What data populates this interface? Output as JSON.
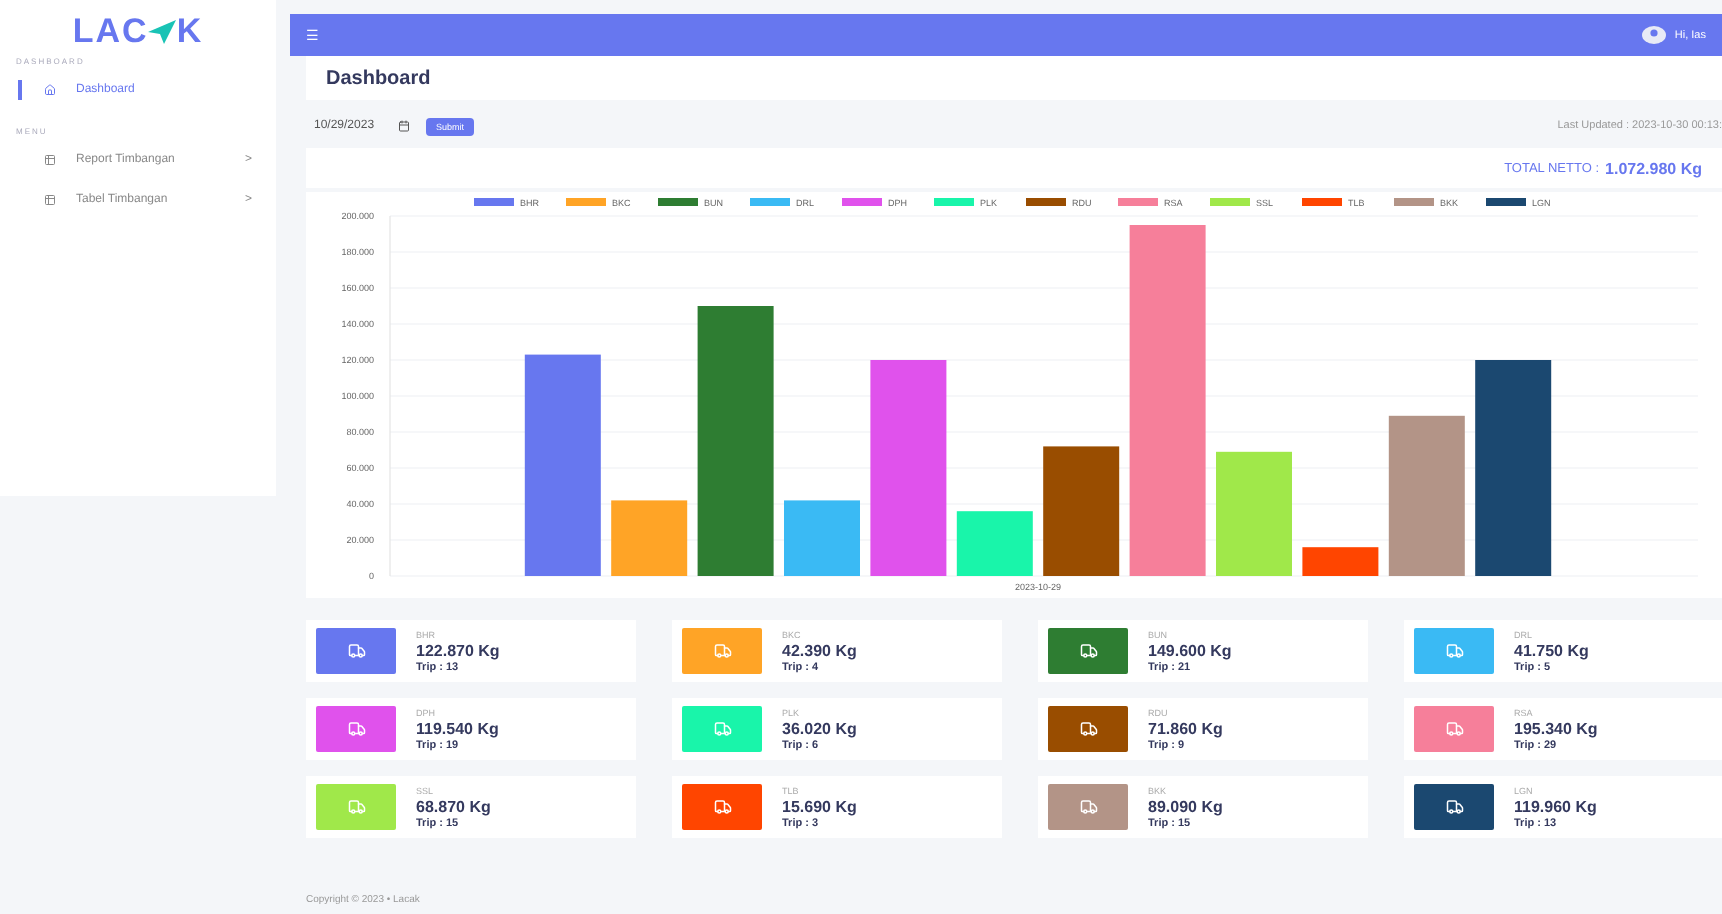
{
  "sidebar": {
    "logo": {
      "left": "LAC",
      "right": "K"
    },
    "sections": [
      {
        "heading": "DASHBOARD",
        "items": [
          {
            "label": "Dashboard",
            "selected": true
          }
        ]
      },
      {
        "heading": "MENU",
        "items": [
          {
            "label": "Report Timbangan",
            "selected": false,
            "arrow": ">"
          },
          {
            "label": "Tabel Timbangan",
            "selected": false,
            "arrow": ">"
          }
        ]
      }
    ]
  },
  "topbar": {
    "menu_icon": "☰",
    "user": "Hi, Ias"
  },
  "header": {
    "title": "Dashboard"
  },
  "filter": {
    "date": "10/29/2023",
    "submit": "Submit",
    "last_updated": "Last Updated : 2023-10-30 00:13:"
  },
  "total": {
    "label": "TOTAL NETTO :",
    "value": "1.072.980 Kg"
  },
  "chart": {
    "chart_data": {
      "type": "bar",
      "categories": [
        "2023-10-29"
      ],
      "ylim": [
        0,
        200000
      ],
      "grid": true,
      "legend": true,
      "yticks": [
        {
          "value": 0,
          "label": "0"
        },
        {
          "value": 20000,
          "label": "20.000"
        },
        {
          "value": 40000,
          "label": "40.000"
        },
        {
          "value": 60000,
          "label": "60.000"
        },
        {
          "value": 80000,
          "label": "80.000"
        },
        {
          "value": 100000,
          "label": "100.000"
        },
        {
          "value": 120000,
          "label": "120.000"
        },
        {
          "value": 140000,
          "label": "140.000"
        },
        {
          "value": 160000,
          "label": "160.000"
        },
        {
          "value": 180000,
          "label": "180.000"
        },
        {
          "value": 200000,
          "label": "200.000"
        }
      ],
      "series": [
        {
          "name": "BHR",
          "color": "#6777ef",
          "values": [
            123000
          ]
        },
        {
          "name": "BKC",
          "color": "#ffa426",
          "values": [
            42000
          ]
        },
        {
          "name": "BUN",
          "color": "#2e7d32",
          "values": [
            150000
          ]
        },
        {
          "name": "DRL",
          "color": "#3abaf4",
          "values": [
            42000
          ]
        },
        {
          "name": "DPH",
          "color": "#e052ec",
          "values": [
            120000
          ]
        },
        {
          "name": "PLK",
          "color": "#19f5aa",
          "values": [
            36000
          ]
        },
        {
          "name": "RDU",
          "color": "#994d00",
          "values": [
            72000
          ]
        },
        {
          "name": "RSA",
          "color": "#f67f9a",
          "values": [
            195000
          ]
        },
        {
          "name": "SSL",
          "color": "#a0e84a",
          "values": [
            69000
          ]
        },
        {
          "name": "TLB",
          "color": "#ff4500",
          "values": [
            16000
          ]
        },
        {
          "name": "BKK",
          "color": "#b39487",
          "values": [
            89000
          ]
        },
        {
          "name": "LGN",
          "color": "#1b4870",
          "values": [
            120000
          ]
        }
      ]
    }
  },
  "stats": [
    {
      "code": "BHR",
      "weight": "122.870 Kg",
      "trips": "Trip : 13",
      "color": "#6777ef"
    },
    {
      "code": "BKC",
      "weight": "42.390 Kg",
      "trips": "Trip : 4",
      "color": "#ffa426"
    },
    {
      "code": "BUN",
      "weight": "149.600 Kg",
      "trips": "Trip : 21",
      "color": "#2e7d32"
    },
    {
      "code": "DRL",
      "weight": "41.750 Kg",
      "trips": "Trip : 5",
      "color": "#3abaf4"
    },
    {
      "code": "DPH",
      "weight": "119.540 Kg",
      "trips": "Trip : 19",
      "color": "#e052ec"
    },
    {
      "code": "PLK",
      "weight": "36.020 Kg",
      "trips": "Trip : 6",
      "color": "#19f5aa"
    },
    {
      "code": "RDU",
      "weight": "71.860 Kg",
      "trips": "Trip : 9",
      "color": "#994d00"
    },
    {
      "code": "RSA",
      "weight": "195.340 Kg",
      "trips": "Trip : 29",
      "color": "#f67f9a"
    },
    {
      "code": "SSL",
      "weight": "68.870 Kg",
      "trips": "Trip : 15",
      "color": "#a0e84a"
    },
    {
      "code": "TLB",
      "weight": "15.690 Kg",
      "trips": "Trip : 3",
      "color": "#ff4500"
    },
    {
      "code": "BKK",
      "weight": "89.090 Kg",
      "trips": "Trip : 15",
      "color": "#b39487"
    },
    {
      "code": "LGN",
      "weight": "119.960 Kg",
      "trips": "Trip : 13",
      "color": "#1b4870"
    }
  ],
  "footer": {
    "text": "Copyright © 2023 • Lacak"
  }
}
